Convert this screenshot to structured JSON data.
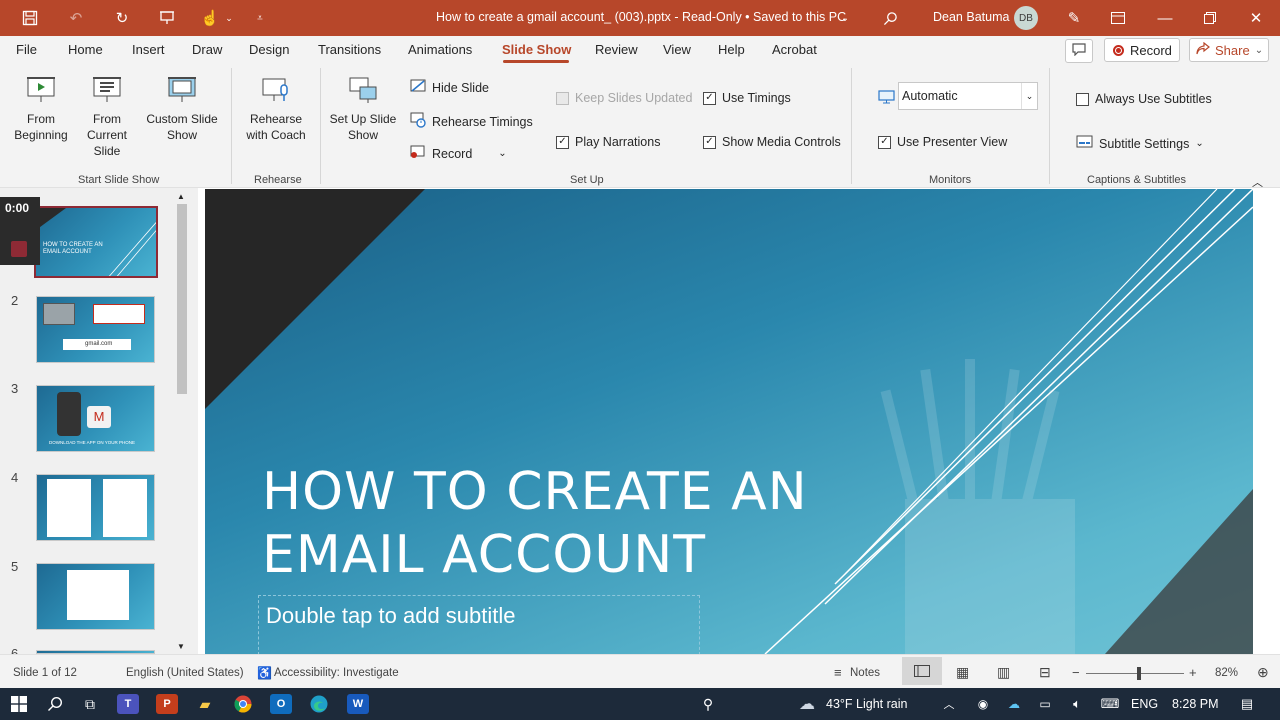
{
  "titlebar": {
    "document_title": "How to create a gmail account_ (003).pptx  -  Read-Only  •  Saved to this PC",
    "user_name": "Dean Batuma",
    "user_initials": "DB"
  },
  "tabs": [
    "File",
    "Home",
    "Insert",
    "Draw",
    "Design",
    "Transitions",
    "Animations",
    "Slide Show",
    "Review",
    "View",
    "Help",
    "Acrobat"
  ],
  "active_tab": "Slide Show",
  "top_actions": {
    "record_label": "Record",
    "share_label": "Share"
  },
  "ribbon": {
    "start": {
      "from_beginning": "From Beginning",
      "from_current": "From Current Slide",
      "custom_show": "Custom Slide Show",
      "group_label": "Start Slide Show"
    },
    "rehearse": {
      "coach": "Rehearse with Coach",
      "group_label": "Rehearse"
    },
    "setup": {
      "set_up_show": "Set Up Slide Show",
      "hide_slide": "Hide Slide",
      "rehearse_timings": "Rehearse Timings",
      "record": "Record",
      "keep_updated": "Keep Slides Updated",
      "play_narrations": "Play Narrations",
      "use_timings": "Use Timings",
      "show_media_controls": "Show Media Controls",
      "group_label": "Set Up"
    },
    "monitors": {
      "monitor_value": "Automatic",
      "use_presenter_view": "Use Presenter View",
      "group_label": "Monitors"
    },
    "captions": {
      "always_subtitles": "Always Use Subtitles",
      "subtitle_settings": "Subtitle Settings",
      "group_label": "Captions & Subtitles"
    }
  },
  "checkbox_states": {
    "keep_updated": false,
    "play_narrations": true,
    "use_timings": true,
    "show_media_controls": true,
    "use_presenter_view": true,
    "always_subtitles": false
  },
  "thumbnails": {
    "numbers": [
      "2",
      "3",
      "4",
      "5",
      "6"
    ],
    "slide1_text": "HOW TO CREATE AN EMAIL ACCOUNT",
    "slide2_search": "gmail.com",
    "slide3_caption": "DOWNLOAD THE APP ON YOUR PHONE"
  },
  "timer": "0:00",
  "slide": {
    "title_line1": "HOW TO CREATE AN",
    "title_line2": "EMAIL ACCOUNT",
    "subtitle_placeholder": "Double tap to add subtitle"
  },
  "status": {
    "slide_count": "Slide 1 of 12",
    "language": "English (United States)",
    "accessibility": "Accessibility: Investigate",
    "notes": "Notes",
    "zoom": "82%",
    "zoom_level": 0.52
  },
  "taskbar": {
    "weather": "43°F  Light rain",
    "language": "ENG",
    "time": "8:28 PM"
  },
  "colors": {
    "accent": "#b7472a",
    "slide_blue": "#2a87ad",
    "taskbar": "#1d2a3a"
  }
}
